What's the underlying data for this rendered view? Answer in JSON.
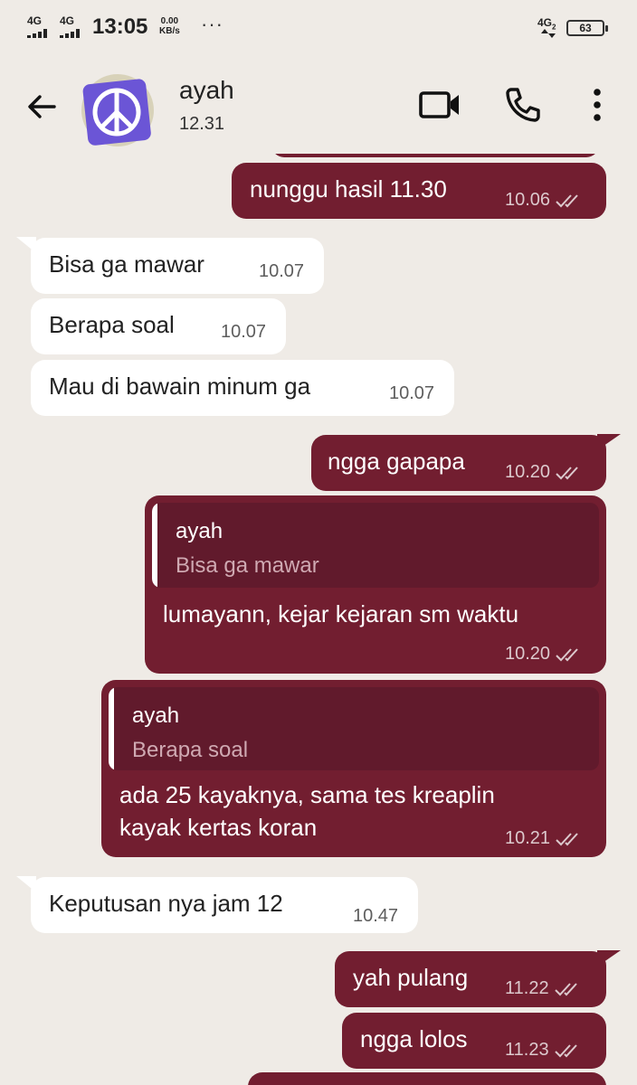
{
  "status_bar": {
    "network_left_1": "4G",
    "network_left_2": "4G",
    "time": "13:05",
    "speed_value": "0.00",
    "speed_unit": "KB/s",
    "more": "···",
    "network_right": "4G",
    "network_right_sub": "2",
    "battery": "63"
  },
  "header": {
    "contact_name": "ayah",
    "contact_status": "12.31",
    "avatar_icon": "peace-sign-icon",
    "back_icon": "arrow-left-icon",
    "video_icon": "video-camera-icon",
    "call_icon": "phone-icon",
    "menu_icon": "more-vertical-icon"
  },
  "colors": {
    "background": "#efebe6",
    "outgoing_bubble": "#721e30",
    "incoming_bubble": "#ffffff",
    "quote_bg": "#611a2c"
  },
  "messages": [
    {
      "direction": "out",
      "text": "nunggu hasil 11.30",
      "time": "10.06",
      "status": "read-ticks"
    },
    {
      "direction": "in",
      "text": "Bisa ga mawar",
      "time": "10.07"
    },
    {
      "direction": "in",
      "text": "Berapa soal",
      "time": "10.07"
    },
    {
      "direction": "in",
      "text": "Mau di bawain minum ga",
      "time": "10.07"
    },
    {
      "direction": "out",
      "text": "ngga gapapa",
      "time": "10.20",
      "status": "read-ticks"
    },
    {
      "direction": "out",
      "reply_to": {
        "name": "ayah",
        "text": "Bisa ga mawar"
      },
      "text": "lumayann, kejar kejaran sm waktu",
      "time": "10.20",
      "status": "read-ticks"
    },
    {
      "direction": "out",
      "reply_to": {
        "name": "ayah",
        "text": "Berapa soal"
      },
      "text_line1": "ada 25 kayaknya, sama tes kreaplin",
      "text_line2": "kayak kertas koran",
      "time": "10.21",
      "status": "read-ticks"
    },
    {
      "direction": "in",
      "text": "Keputusan nya jam 12",
      "time": "10.47"
    },
    {
      "direction": "out",
      "text": "yah pulang",
      "time": "11.22",
      "status": "read-ticks"
    },
    {
      "direction": "out",
      "text": "ngga lolos",
      "time": "11.23",
      "status": "read-ticks"
    }
  ]
}
